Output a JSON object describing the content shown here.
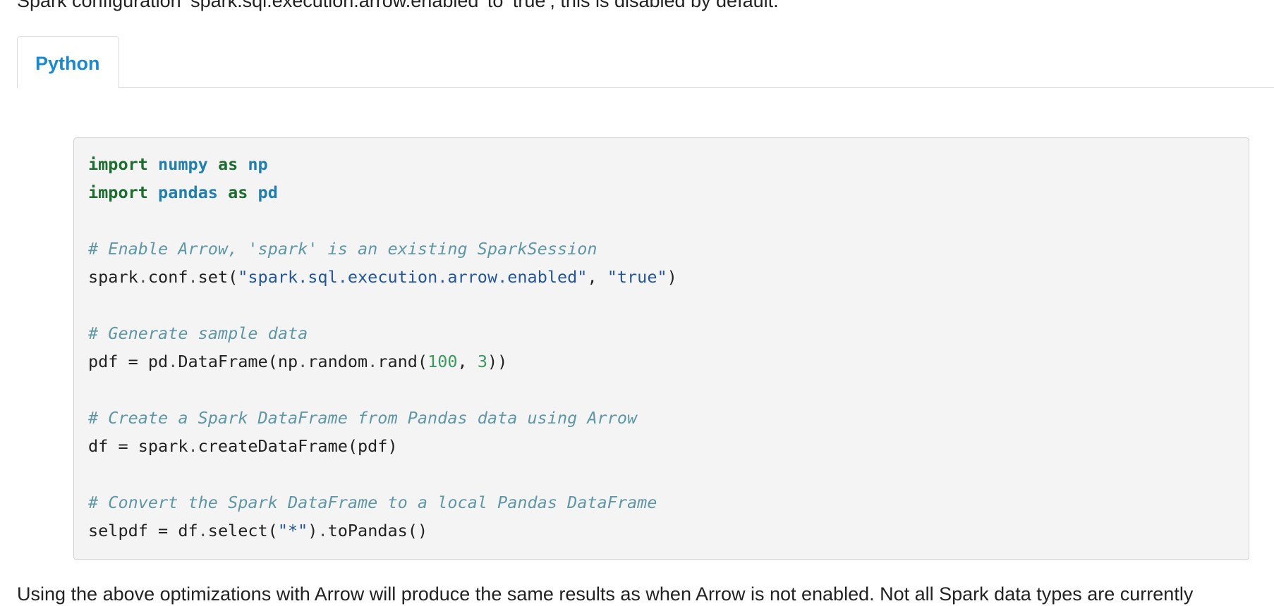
{
  "intro_text": "Spark configuration ‘spark.sql.execution.arrow.enabled’ to ‘true’, this is disabled by default.",
  "tabs": [
    {
      "label": "Python"
    }
  ],
  "code": {
    "line1": {
      "kw1": "import",
      "mod": "numpy",
      "kw2": "as",
      "alias": "np"
    },
    "line2": {
      "kw1": "import",
      "mod": "pandas",
      "kw2": "as",
      "alias": "pd"
    },
    "comment1": "# Enable Arrow, 'spark' is an existing SparkSession",
    "line4": {
      "pre1": "spark",
      "dot1": ".",
      "pre2": "conf",
      "dot2": ".",
      "pre3": "set(",
      "str1": "\"spark.sql.execution.arrow.enabled\"",
      "sep": ", ",
      "str2": "\"true\"",
      "post": ")"
    },
    "comment2": "# Generate sample data",
    "line6": {
      "pre1": "pdf = pd",
      "dot1": ".",
      "pre2": "DataFrame(np",
      "dot2": ".",
      "pre3": "random",
      "dot3": ".",
      "pre4": "rand(",
      "num1": "100",
      "sep": ", ",
      "num2": "3",
      "post": "))"
    },
    "comment3": "# Create a Spark DataFrame from Pandas data using Arrow",
    "line8": {
      "pre1": "df = spark",
      "dot1": ".",
      "post": "createDataFrame(pdf)"
    },
    "comment4": "# Convert the Spark DataFrame to a local Pandas DataFrame",
    "line10": {
      "pre1": "selpdf = df",
      "dot1": ".",
      "pre2": "select(",
      "str1": "\"*\"",
      "pre3": ")",
      "dot2": ".",
      "post": "toPandas()"
    }
  },
  "outro_text": "Using the above optimizations with Arrow will produce the same results as when Arrow is not enabled. Not all Spark data types are currently",
  "colors": {
    "tab_active": "#1a8ad0",
    "keyword": "#1b6e2e",
    "module": "#1f7fae",
    "comment": "#5f97a6",
    "string": "#24579a",
    "number": "#3c9a5f",
    "code_background": "#f4f4f4"
  }
}
